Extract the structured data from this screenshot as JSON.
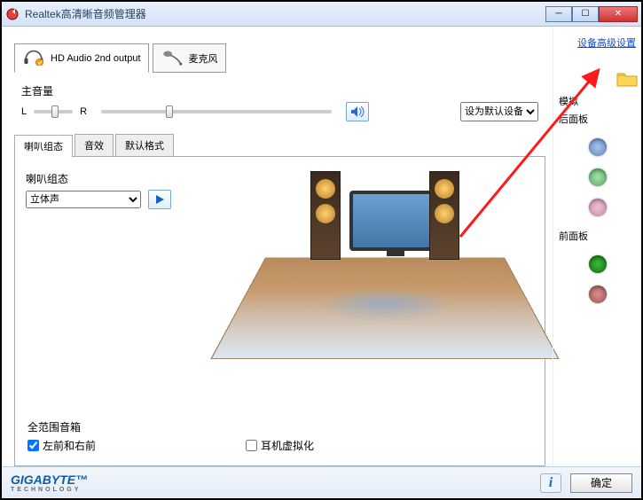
{
  "window": {
    "title": "Realtek高清晰音频管理器"
  },
  "outputs": [
    {
      "label": "HD Audio 2nd output",
      "active": true
    },
    {
      "label": "麦克风",
      "active": false
    }
  ],
  "volume": {
    "section_label": "主音量",
    "left_letter": "L",
    "right_letter": "R",
    "balance_pct": 50,
    "main_pct": 30
  },
  "default_device": {
    "selected": "设为默认设备",
    "options": [
      "设为默认设备"
    ]
  },
  "inner_tabs": [
    "喇叭组态",
    "音效",
    "默认格式"
  ],
  "active_inner_tab": 0,
  "speaker_config": {
    "label": "喇叭组态",
    "selected": "立体声",
    "options": [
      "立体声"
    ]
  },
  "surround": {
    "group_label": "全范围音箱",
    "opt_lr": "左前和右前",
    "opt_lr_checked": true
  },
  "virtualization": {
    "label": "耳机虚拟化",
    "checked": false
  },
  "right": {
    "advanced_link": "设备高级设置",
    "analog_label": "模拟",
    "back_panel": "后面板",
    "front_panel": "前面板"
  },
  "footer": {
    "brand": "GIGABYTE",
    "brand_sub": "TECHNOLOGY",
    "ok": "确定"
  }
}
